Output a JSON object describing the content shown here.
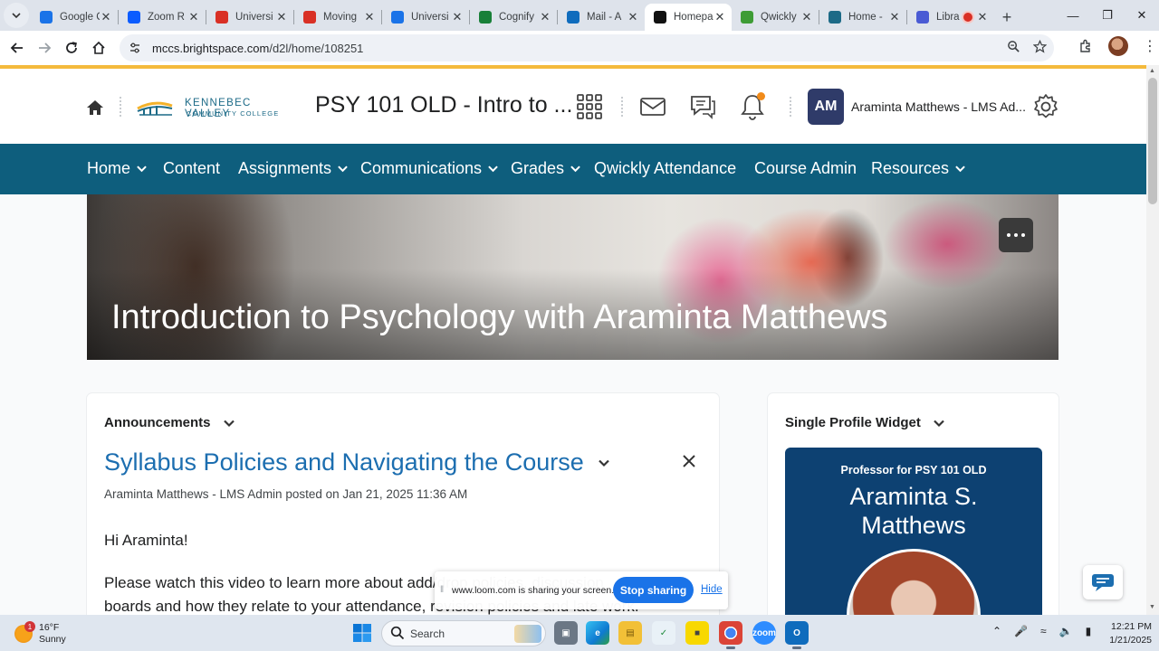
{
  "browser": {
    "tabs": [
      {
        "title": "Google C",
        "icon": "google-calendar-icon",
        "color": "#1a73e8",
        "glyph": "17"
      },
      {
        "title": "Zoom R",
        "icon": "zoom-icon",
        "color": "#0b5cff",
        "glyph": "Z"
      },
      {
        "title": "Universi",
        "icon": "gmail-icon",
        "color": "#d93025",
        "glyph": "M"
      },
      {
        "title": "Moving",
        "icon": "gmail-icon",
        "color": "#d93025",
        "glyph": "M"
      },
      {
        "title": "Universi",
        "icon": "calendar-icon",
        "color": "#1a73e8",
        "glyph": "14"
      },
      {
        "title": "Cognify",
        "icon": "sheets-icon",
        "color": "#188038",
        "glyph": "+"
      },
      {
        "title": "Mail - A",
        "icon": "outlook-icon",
        "color": "#0f6cbd",
        "glyph": "O"
      },
      {
        "title": "Homepa",
        "icon": "d2l-icon",
        "color": "#111111",
        "glyph": "D2L",
        "active": true
      },
      {
        "title": "Qwickly",
        "icon": "qwickly-icon",
        "color": "#3e9c35",
        "glyph": "Q"
      },
      {
        "title": "Home -",
        "icon": "kvcc-icon",
        "color": "#1c6a87",
        "glyph": "K"
      },
      {
        "title": "Libra",
        "icon": "library-icon",
        "color": "#4a5bd4",
        "glyph": "L",
        "recording": true
      }
    ],
    "url_host": "mccs.brightspace.com",
    "url_path": "/d2l/home/108251"
  },
  "header": {
    "course_title": "PSY 101 OLD - Intro to ...",
    "logo_line1": "KENNEBEC VALLEY",
    "logo_line2": "COMMUNITY COLLEGE",
    "avatar_initials": "AM",
    "user_name": "Araminta Matthews - LMS Ad..."
  },
  "nav": {
    "items": [
      {
        "label": "Home",
        "dropdown": true
      },
      {
        "label": "Content",
        "dropdown": false
      },
      {
        "label": "Assignments",
        "dropdown": true
      },
      {
        "label": "Communications",
        "dropdown": true
      },
      {
        "label": "Grades",
        "dropdown": true
      },
      {
        "label": "Qwickly Attendance",
        "dropdown": false
      },
      {
        "label": "Course Admin",
        "dropdown": false
      },
      {
        "label": "Resources",
        "dropdown": true
      }
    ]
  },
  "banner": {
    "title": "Introduction to Psychology with Araminta Matthews"
  },
  "announcements": {
    "widget_title": "Announcements",
    "item_title": "Syllabus Policies and Navigating the Course",
    "meta": "Araminta Matthews - LMS Admin posted on Jan 21, 2025 11:36 AM",
    "greeting": "Hi Araminta!",
    "body_line1": "Please watch this video to learn more about add/drop policies, discussion",
    "body_line2": "boards and how they relate to your attendance, revision policies and late work."
  },
  "profile_widget": {
    "widget_title": "Single Profile Widget",
    "role": "Professor for PSY 101 OLD",
    "name": "Araminta S. Matthews"
  },
  "loom": {
    "message": "www.loom.com is sharing your screen.",
    "stop_label": "Stop sharing",
    "hide_label": "Hide"
  },
  "taskbar": {
    "weather_temp": "16°F",
    "weather_cond": "Sunny",
    "weather_badge": "1",
    "search_label": "Search",
    "time": "12:21 PM",
    "date": "1/21/2025"
  },
  "colors": {
    "nav_bg": "#0e5e7d",
    "link": "#1c6eb0",
    "profile_bg": "#0d4172",
    "load_bar": "#f4ba3c",
    "avatar_bg": "#2f3b69"
  }
}
